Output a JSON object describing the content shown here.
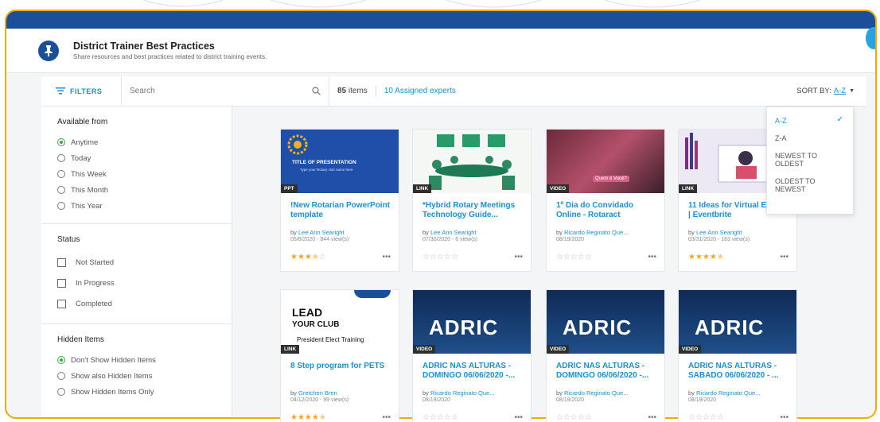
{
  "header": {
    "title": "District Trainer Best Practices",
    "subtitle": "Share resources and best practices related to district training events."
  },
  "toolbar": {
    "filters_label": "FILTERS",
    "search_placeholder": "Search",
    "items_count": "85",
    "items_suffix": "items",
    "experts": "10 Assigned experts",
    "sort_label": "SORT BY:",
    "sort_value": "A-Z"
  },
  "sidebar": {
    "available_title": "Available from",
    "available_options": [
      "Anytime",
      "Today",
      "This Week",
      "This Month",
      "This Year"
    ],
    "status_title": "Status",
    "status_options": [
      "Not Started",
      "In Progress",
      "Completed"
    ],
    "hidden_title": "Hidden Items",
    "hidden_options": [
      "Don't Show Hidden Items",
      "Show also Hidden Items",
      "Show Hidden Items Only"
    ]
  },
  "sort_menu": [
    "A-Z",
    "Z-A",
    "NEWEST TO OLDEST",
    "OLDEST TO NEWEST"
  ],
  "cards": [
    {
      "tag": "PPT",
      "title": "!New Rotarian PowerPoint template",
      "author": "Lee Ann Searight",
      "meta": "05/8/2020 - 844 view(s)",
      "rating": 3.5,
      "thumb_title": "TITLE OF PRESENTATION",
      "thumb_sub": "Type your Rotary club name here"
    },
    {
      "tag": "LINK",
      "title": "*Hybrid Rotary Meetings Technology Guide...",
      "author": "Lee Ann Searight",
      "meta": "07/30/2020 - 6 view(s)",
      "rating": 0
    },
    {
      "tag": "VIDEO",
      "title": "1º Dia do Convidado Online - Rotaract",
      "author": "Ricardo Reginato Que...",
      "meta": "08/19/2020",
      "rating": 0,
      "thumb_title": "Quem é Você?"
    },
    {
      "tag": "LINK",
      "title": "11 Ideas for Virtual Events | Eventbrite",
      "author": "Lee Ann Searight",
      "meta": "03/31/2020 - 163 view(s)",
      "rating": 4.5
    },
    {
      "tag": "LINK",
      "title": "8 Step program for PETS",
      "author": "Gretchen Bren",
      "meta": "04/12/2020 - 99 view(s)",
      "rating": 4.5,
      "thumb_title": "LEAD",
      "thumb_sub": "YOUR CLUB",
      "thumb_sub2": "President Elect Training"
    },
    {
      "tag": "VIDEO",
      "title": "ADRIC NAS ALTURAS - DOMINGO 06/06/2020 -...",
      "author": "Ricardo Reginato Que...",
      "meta": "08/19/2020",
      "rating": 0,
      "thumb_title": "ADRIC"
    },
    {
      "tag": "VIDEO",
      "title": "ADRIC NAS ALTURAS - DOMINGO 06/06/2020 -...",
      "author": "Ricardo Reginato Que...",
      "meta": "08/19/2020",
      "rating": 0,
      "thumb_title": "ADRIC"
    },
    {
      "tag": "VIDEO",
      "title": "ADRIC NAS ALTURAS - SABADO 06/06/2020 - ...",
      "author": "Ricardo Reginato Que...",
      "meta": "08/19/2020",
      "rating": 0,
      "thumb_title": "ADRIC"
    }
  ],
  "by_prefix": "by",
  "colors": {
    "brand_blue": "#1b4f9a",
    "accent": "#1a8fd1",
    "frame": "#f2a900",
    "star": "#f5a623"
  },
  "icons": {
    "pin": "pin-icon",
    "filters": "filter-icon",
    "search": "search-icon",
    "check": "check-icon"
  }
}
